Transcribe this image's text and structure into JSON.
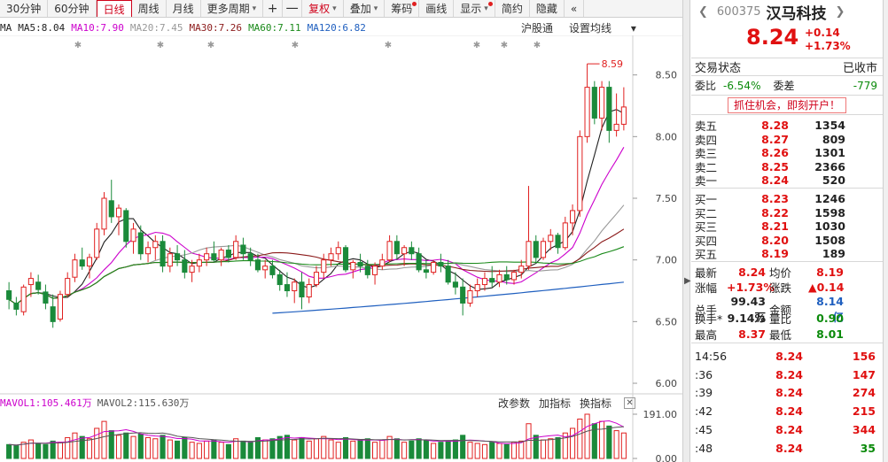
{
  "toolbar": {
    "items": [
      {
        "label": "30分钟"
      },
      {
        "label": "60分钟"
      },
      {
        "label": "日线",
        "active": true
      },
      {
        "label": "周线"
      },
      {
        "label": "月线"
      },
      {
        "label": "更多周期",
        "caret": true
      },
      {
        "label": "+",
        "square": true
      },
      {
        "label": "一",
        "square": true
      },
      {
        "label": "复权",
        "caret": true,
        "red": true
      },
      {
        "label": "叠加",
        "caret": true
      },
      {
        "label": "筹码",
        "dot": true
      },
      {
        "label": "画线"
      },
      {
        "label": "显示",
        "caret": true,
        "dot": true
      },
      {
        "label": "简约"
      },
      {
        "label": "隐藏"
      },
      {
        "label": "«"
      }
    ]
  },
  "ma_legend": [
    {
      "text": "MA",
      "color": "#222222"
    },
    {
      "text": "MA5:8.04",
      "color": "#222222"
    },
    {
      "text": "MA10:7.90",
      "color": "#cc00cc"
    },
    {
      "text": "MA20:7.45",
      "color": "#999999"
    },
    {
      "text": "MA30:7.26",
      "color": "#8b1a1a"
    },
    {
      "text": "MA60:7.11",
      "color": "#1a8a1a"
    },
    {
      "text": "MA120:6.82",
      "color": "#1f5fbf"
    }
  ],
  "chart_links": [
    "沪股通",
    "设置均线"
  ],
  "price_axis": [
    "8.50",
    "8.00",
    "7.50",
    "7.00",
    "6.50",
    "6.00"
  ],
  "max_marker": "8.59",
  "vol_legend": [
    {
      "text": "MAVOL1:105.461万",
      "color": "#cc00cc"
    },
    {
      "text": "MAVOL2:115.630万",
      "color": "#555555"
    }
  ],
  "vol_links": [
    "改参数",
    "加指标",
    "换指标"
  ],
  "vol_axis": [
    "191.00",
    "0.00"
  ],
  "chart_data": {
    "type": "candlestick",
    "ylim": [
      5.95,
      8.72
    ],
    "candles": [
      [
        6.75,
        6.82,
        6.6,
        6.68
      ],
      [
        6.65,
        6.7,
        6.55,
        6.6
      ],
      [
        6.58,
        6.8,
        6.55,
        6.78
      ],
      [
        6.8,
        6.9,
        6.7,
        6.85
      ],
      [
        6.82,
        6.88,
        6.72,
        6.76
      ],
      [
        6.74,
        6.8,
        6.6,
        6.65
      ],
      [
        6.62,
        6.72,
        6.45,
        6.5
      ],
      [
        6.52,
        6.75,
        6.5,
        6.72
      ],
      [
        6.72,
        6.9,
        6.7,
        6.85
      ],
      [
        6.86,
        7.05,
        6.82,
        7.0
      ],
      [
        7.0,
        7.1,
        6.92,
        6.95
      ],
      [
        6.95,
        7.05,
        6.85,
        7.02
      ],
      [
        7.02,
        7.3,
        7.0,
        7.25
      ],
      [
        7.25,
        7.55,
        7.2,
        7.5
      ],
      [
        7.48,
        7.65,
        7.3,
        7.35
      ],
      [
        7.35,
        7.45,
        7.2,
        7.42
      ],
      [
        7.4,
        7.42,
        7.1,
        7.15
      ],
      [
        7.15,
        7.3,
        7.05,
        7.25
      ],
      [
        7.22,
        7.28,
        7.0,
        7.05
      ],
      [
        7.05,
        7.15,
        6.98,
        7.1
      ],
      [
        7.1,
        7.2,
        7.0,
        7.15
      ],
      [
        7.15,
        7.2,
        6.9,
        6.95
      ],
      [
        6.95,
        7.1,
        6.9,
        7.05
      ],
      [
        7.05,
        7.12,
        6.95,
        7.0
      ],
      [
        7.0,
        7.08,
        6.85,
        6.9
      ],
      [
        6.9,
        7.0,
        6.82,
        6.95
      ],
      [
        6.95,
        7.05,
        6.9,
        7.0
      ],
      [
        7.0,
        7.1,
        6.95,
        7.05
      ],
      [
        7.05,
        7.15,
        6.98,
        7.0
      ],
      [
        7.0,
        7.1,
        6.95,
        7.08
      ],
      [
        7.08,
        7.12,
        6.98,
        7.02
      ],
      [
        7.02,
        7.2,
        7.0,
        7.15
      ],
      [
        7.12,
        7.18,
        7.0,
        7.05
      ],
      [
        7.05,
        7.1,
        6.95,
        7.0
      ],
      [
        7.0,
        7.05,
        6.9,
        6.92
      ],
      [
        6.92,
        7.0,
        6.85,
        6.95
      ],
      [
        6.95,
        7.0,
        6.85,
        6.88
      ],
      [
        6.88,
        6.92,
        6.75,
        6.8
      ],
      [
        6.8,
        6.9,
        6.7,
        6.75
      ],
      [
        6.75,
        6.85,
        6.65,
        6.82
      ],
      [
        6.82,
        6.9,
        6.6,
        6.7
      ],
      [
        6.7,
        6.85,
        6.65,
        6.8
      ],
      [
        6.8,
        6.95,
        6.78,
        6.9
      ],
      [
        6.9,
        7.05,
        6.85,
        7.0
      ],
      [
        7.0,
        7.1,
        6.95,
        7.05
      ],
      [
        7.05,
        7.15,
        7.0,
        7.1
      ],
      [
        7.1,
        7.12,
        6.9,
        6.92
      ],
      [
        6.92,
        7.0,
        6.85,
        6.98
      ],
      [
        6.98,
        7.05,
        6.9,
        6.95
      ],
      [
        6.95,
        7.0,
        6.85,
        6.88
      ],
      [
        6.88,
        6.98,
        6.8,
        6.95
      ],
      [
        6.95,
        7.05,
        6.92,
        7.0
      ],
      [
        7.0,
        7.2,
        6.98,
        7.15
      ],
      [
        7.15,
        7.2,
        7.0,
        7.05
      ],
      [
        7.05,
        7.12,
        6.95,
        7.1
      ],
      [
        7.1,
        7.15,
        7.0,
        7.05
      ],
      [
        7.05,
        7.1,
        6.9,
        6.92
      ],
      [
        6.92,
        7.0,
        6.85,
        6.9
      ],
      [
        6.9,
        7.0,
        6.88,
        6.98
      ],
      [
        6.98,
        7.05,
        6.9,
        6.95
      ],
      [
        6.95,
        7.0,
        6.8,
        6.82
      ],
      [
        6.82,
        6.9,
        6.72,
        6.78
      ],
      [
        6.78,
        6.85,
        6.55,
        6.65
      ],
      [
        6.65,
        6.8,
        6.62,
        6.75
      ],
      [
        6.75,
        6.85,
        6.7,
        6.8
      ],
      [
        6.8,
        6.9,
        6.75,
        6.85
      ],
      [
        6.85,
        6.95,
        6.78,
        6.82
      ],
      [
        6.82,
        6.92,
        6.78,
        6.88
      ],
      [
        6.88,
        6.95,
        6.8,
        6.84
      ],
      [
        6.84,
        6.92,
        6.8,
        6.9
      ],
      [
        6.9,
        7.0,
        6.85,
        6.95
      ],
      [
        6.95,
        7.6,
        6.92,
        7.15
      ],
      [
        7.15,
        7.2,
        6.98,
        7.02
      ],
      [
        7.02,
        7.18,
        7.0,
        7.15
      ],
      [
        7.15,
        7.25,
        7.08,
        7.2
      ],
      [
        7.2,
        7.22,
        7.05,
        7.1
      ],
      [
        7.1,
        7.35,
        7.08,
        7.3
      ],
      [
        7.3,
        7.45,
        7.2,
        7.4
      ],
      [
        7.4,
        8.05,
        7.35,
        8.0
      ],
      [
        8.0,
        8.59,
        7.95,
        8.4
      ],
      [
        8.4,
        8.45,
        8.1,
        8.15
      ],
      [
        8.15,
        8.45,
        8.05,
        8.4
      ],
      [
        8.4,
        8.45,
        7.95,
        8.05
      ],
      [
        8.05,
        8.35,
        8.0,
        8.1
      ],
      [
        8.1,
        8.4,
        8.05,
        8.24
      ]
    ],
    "volumes": [
      60,
      55,
      70,
      80,
      65,
      60,
      75,
      70,
      90,
      110,
      95,
      85,
      130,
      160,
      120,
      100,
      110,
      95,
      105,
      90,
      85,
      100,
      80,
      75,
      90,
      70,
      65,
      75,
      80,
      70,
      60,
      85,
      75,
      70,
      90,
      80,
      85,
      95,
      100,
      80,
      90,
      75,
      85,
      95,
      80,
      70,
      90,
      75,
      80,
      85,
      70,
      80,
      95,
      85,
      70,
      75,
      85,
      80,
      65,
      70,
      75,
      80,
      100,
      70,
      65,
      60,
      70,
      65,
      60,
      70,
      75,
      150,
      100,
      80,
      85,
      90,
      110,
      130,
      170,
      191,
      150,
      160,
      140,
      120,
      110
    ],
    "ma_series": [
      {
        "name": "MA5",
        "color": "#222222"
      },
      {
        "name": "MA10",
        "color": "#cc00cc"
      },
      {
        "name": "MA20",
        "color": "#999999"
      },
      {
        "name": "MA30",
        "color": "#8b1a1a"
      },
      {
        "name": "MA60",
        "color": "#1a8a1a"
      },
      {
        "name": "MA120",
        "color": "#1f5fbf"
      }
    ]
  },
  "panel": {
    "code": "600375",
    "name": "汉马科技",
    "price": "8.24",
    "change": "+0.14",
    "change_pct": "+1.73%",
    "status_label": "交易状态",
    "status_value": "已收市",
    "wei_bi_label": "委比",
    "wei_bi": "-6.54%",
    "wei_cha_label": "委差",
    "wei_cha": "-779",
    "promo": "抓住机会，即刻开户！",
    "asks": [
      {
        "level": "卖五",
        "price": "8.28",
        "vol": "1354"
      },
      {
        "level": "卖四",
        "price": "8.27",
        "vol": "809"
      },
      {
        "level": "卖三",
        "price": "8.26",
        "vol": "1301"
      },
      {
        "level": "卖二",
        "price": "8.25",
        "vol": "2366"
      },
      {
        "level": "卖一",
        "price": "8.24",
        "vol": "520"
      }
    ],
    "bids": [
      {
        "level": "买一",
        "price": "8.23",
        "vol": "1246"
      },
      {
        "level": "买二",
        "price": "8.22",
        "vol": "1598"
      },
      {
        "level": "买三",
        "price": "8.21",
        "vol": "1030"
      },
      {
        "level": "买四",
        "price": "8.20",
        "vol": "1508"
      },
      {
        "level": "买五",
        "price": "8.19",
        "vol": "189"
      }
    ],
    "stats": [
      {
        "l1": "最新",
        "v1": "8.24",
        "c1": "#e01010",
        "l2": "均价",
        "v2": "8.19",
        "c2": "#e01010"
      },
      {
        "l1": "涨幅",
        "v1": "+1.73%",
        "c1": "#e01010",
        "l2": "涨跌",
        "v2": "▲0.14",
        "c2": "#e01010"
      },
      {
        "l1": "总手",
        "v1": "99.43万",
        "c1": "#222222",
        "l2": "金额",
        "v2": "8.14亿",
        "c2": "#1f5fbf"
      },
      {
        "l1": "换手*",
        "v1": "9.14%",
        "c1": "#222222",
        "l2": "量比",
        "v2": "0.90",
        "c2": "#0a8a0a"
      },
      {
        "l1": "最高",
        "v1": "8.37",
        "c1": "#e01010",
        "l2": "最低",
        "v2": "8.01",
        "c2": "#0a8a0a"
      }
    ],
    "ticks": [
      {
        "time": "14:56",
        "price": "8.24",
        "qty": "156",
        "color": "#e01010"
      },
      {
        "time": ":36",
        "price": "8.24",
        "qty": "147",
        "color": "#e01010"
      },
      {
        "time": ":39",
        "price": "8.24",
        "qty": "274",
        "color": "#e01010"
      },
      {
        "time": ":42",
        "price": "8.24",
        "qty": "215",
        "color": "#e01010"
      },
      {
        "time": ":45",
        "price": "8.24",
        "qty": "344",
        "color": "#e01010"
      },
      {
        "time": ":48",
        "price": "8.24",
        "qty": "35",
        "color": "#0a8a0a"
      }
    ]
  }
}
